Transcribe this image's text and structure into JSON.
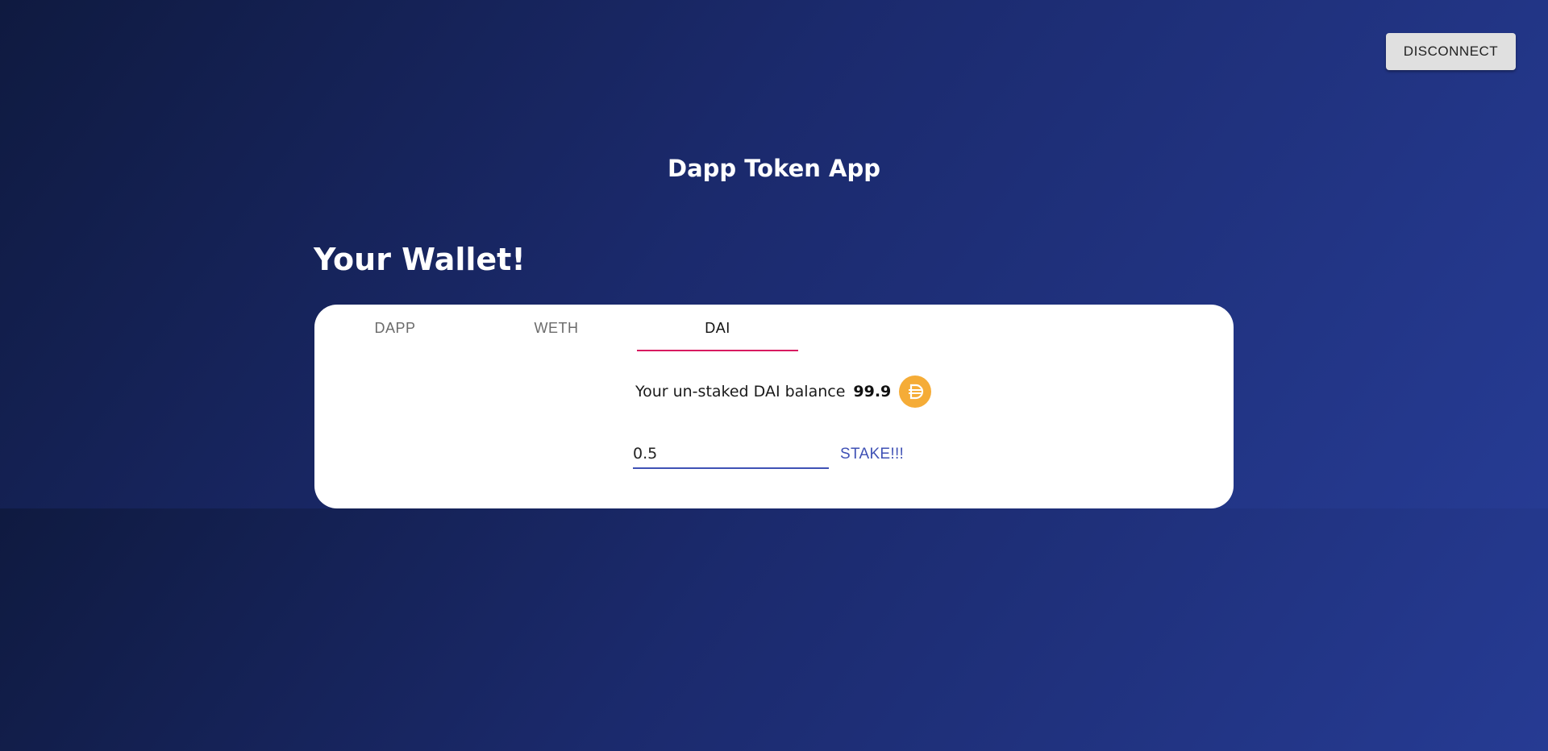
{
  "header": {
    "disconnect_label": "DISCONNECT",
    "app_title": "Dapp Token App"
  },
  "wallet": {
    "heading": "Your Wallet!",
    "tabs": [
      {
        "label": "DAPP",
        "active": false
      },
      {
        "label": "WETH",
        "active": false
      },
      {
        "label": "DAI",
        "active": true
      }
    ],
    "balance_label": "Your un-staked DAI balance",
    "balance_value": "99.9",
    "token_icon": "dai-icon",
    "stake_input_value": "0.5",
    "stake_button_label": "STAKE!!!"
  },
  "colors": {
    "accent": "#3f51b5",
    "tab_indicator": "#d81b60",
    "dai_icon": "#f5ac37",
    "background_start": "#0f1a40",
    "background_end": "#263b93"
  }
}
